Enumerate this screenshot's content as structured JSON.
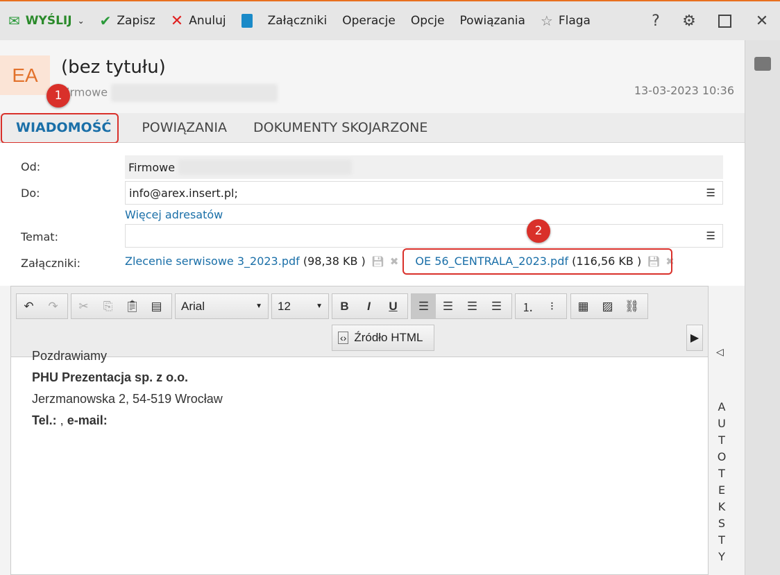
{
  "toolbar": {
    "send": "WYŚLIJ",
    "save": "Zapisz",
    "cancel": "Anuluj",
    "attachments": "Załączniki",
    "operations": "Operacje",
    "options": "Opcje",
    "links": "Powiązania",
    "flag": "Flaga",
    "help": "?"
  },
  "header": {
    "avatar": "EA",
    "title": "(bez tytułu)",
    "from_name": "Firmowe",
    "date": "13-03-2023 10:36"
  },
  "tabs": [
    "WIADOMOŚĆ",
    "POWIĄZANIA",
    "DOKUMENTY SKOJARZONE"
  ],
  "badges": [
    "1",
    "2"
  ],
  "form": {
    "from_label": "Od:",
    "from_value": "Firmowe",
    "to_label": "Do:",
    "to_value": "info@arex.insert.pl;",
    "more_recipients": "Więcej adresatów",
    "subject_label": "Temat:",
    "subject_value": "",
    "attachments_label": "Załączniki:",
    "attachments": [
      {
        "name": "Zlecenie serwisowe 3_2023.pdf",
        "size": "(98,38 KB )"
      },
      {
        "name": "OE 56_CENTRALA_2023.pdf",
        "size": "(116,56 KB )"
      }
    ]
  },
  "editor": {
    "font": "Arial",
    "size": "12",
    "source_html": "Źródło HTML",
    "body": {
      "greeting": "Pozdrawiamy",
      "company": "PHU Prezentacja sp. z o.o.",
      "address": "Jerzmanowska 2, 54-519 Wrocław",
      "tel_label": "Tel.:",
      "sep": " , ",
      "email_label": "e-mail:"
    }
  },
  "autotexts": "AUTOTEKSTY",
  "colors": {
    "accent": "#1a6fa8",
    "highlight": "#d9302a",
    "brand": "#e8701f"
  }
}
